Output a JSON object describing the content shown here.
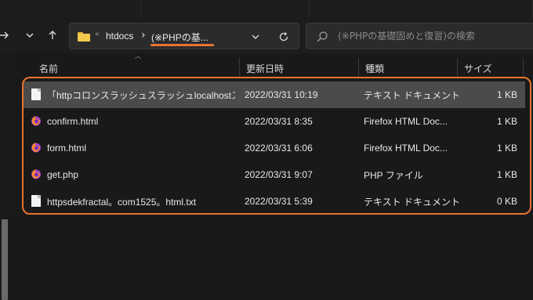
{
  "address": {
    "overflow": "«",
    "crumb1": "htdocs",
    "separator": "›",
    "crumb2": "(※PHPの基..."
  },
  "search": {
    "placeholder": "(※PHPの基礎固めと復習)の検索"
  },
  "columns": {
    "name": "名前",
    "date": "更新日時",
    "type": "種類",
    "size": "サイズ"
  },
  "files": [
    {
      "name": "「httpコロンスラッシュスラッシュlocalhostスラッ...",
      "date": "2022/03/31 10:19",
      "type": "テキスト ドキュメント",
      "size": "1 KB",
      "icon": "text-document-icon"
    },
    {
      "name": "confirm.html",
      "date": "2022/03/31 8:35",
      "type": "Firefox HTML Doc...",
      "size": "1 KB",
      "icon": "firefox-icon"
    },
    {
      "name": "form.html",
      "date": "2022/03/31 6:06",
      "type": "Firefox HTML Doc...",
      "size": "1 KB",
      "icon": "firefox-icon"
    },
    {
      "name": "get.php",
      "date": "2022/03/31 9:07",
      "type": "PHP ファイル",
      "size": "1 KB",
      "icon": "firefox-icon"
    },
    {
      "name": "httpsdekfractal。com1525。html.txt",
      "date": "2022/03/31 5:39",
      "type": "テキスト ドキュメント",
      "size": "0 KB",
      "icon": "text-document-icon"
    }
  ],
  "colors": {
    "highlight": "#e8742f",
    "selected_row": "#4b4b4b",
    "background": "#191919"
  }
}
